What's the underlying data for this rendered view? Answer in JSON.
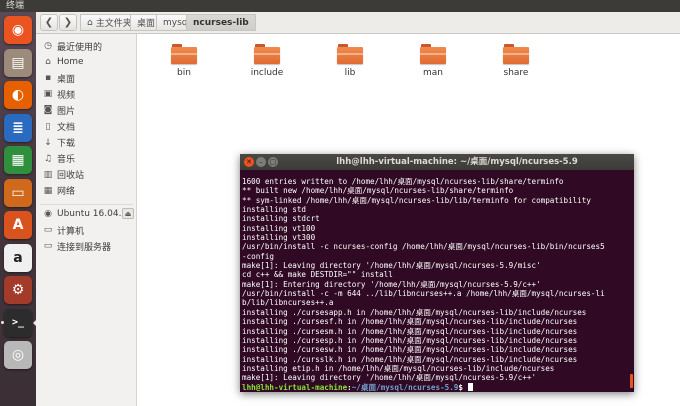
{
  "top_panel": {
    "title": "终端"
  },
  "launcher": {
    "items": [
      {
        "name": "dash",
        "glyph": "◉",
        "color": "#e95420"
      },
      {
        "name": "files",
        "glyph": "▤",
        "color": "#9c8b7a"
      },
      {
        "name": "firefox",
        "glyph": "◐",
        "color": "#e66000"
      },
      {
        "name": "writer",
        "glyph": "≣",
        "color": "#2a6bbf"
      },
      {
        "name": "calc",
        "glyph": "▦",
        "color": "#2f8f3c"
      },
      {
        "name": "impress",
        "glyph": "▭",
        "color": "#d0691c"
      },
      {
        "name": "software-center",
        "glyph": "A",
        "color": "#d9531e"
      },
      {
        "name": "amazon",
        "glyph": "a",
        "color": "#f0f0f0"
      },
      {
        "name": "settings",
        "glyph": "⚙",
        "color": "#a33b2a"
      },
      {
        "name": "terminal",
        "glyph": ">_",
        "color": "#2c2c2c"
      },
      {
        "name": "dvd",
        "glyph": "◎",
        "color": "#b8b8b8"
      }
    ]
  },
  "breadcrumbs": [
    "主文件夹",
    "桌面",
    "mysql",
    "ncurses-lib"
  ],
  "sidebar": {
    "items": [
      {
        "icon": "clock-icon",
        "glyph": "◷",
        "label": "最近使用的"
      },
      {
        "icon": "home-icon",
        "glyph": "⌂",
        "label": "Home"
      },
      {
        "icon": "folder-icon",
        "glyph": "▪",
        "label": "桌面"
      },
      {
        "icon": "video-icon",
        "glyph": "▣",
        "label": "视频"
      },
      {
        "icon": "camera-icon",
        "glyph": "◙",
        "label": "图片"
      },
      {
        "icon": "document-icon",
        "glyph": "▯",
        "label": "文档"
      },
      {
        "icon": "download-icon",
        "glyph": "↓",
        "label": "下载"
      },
      {
        "icon": "music-icon",
        "glyph": "♫",
        "label": "音乐"
      },
      {
        "icon": "trash-icon",
        "glyph": "▥",
        "label": "回收站"
      },
      {
        "icon": "network-icon",
        "glyph": "▦",
        "label": "网络"
      }
    ],
    "devices": [
      {
        "icon": "disc-icon",
        "glyph": "◉",
        "label": "Ubuntu 16.04...."
      },
      {
        "icon": "computer-icon",
        "glyph": "▭",
        "label": "计算机"
      },
      {
        "icon": "server-icon",
        "glyph": "▭",
        "label": "连接到服务器"
      }
    ]
  },
  "folders": [
    "bin",
    "include",
    "lib",
    "man",
    "share"
  ],
  "terminal": {
    "title": "lhh@lhh-virtual-machine: ~/桌面/mysql/ncurses-5.9",
    "lines": [
      "1600 entries written to /home/lhh/桌面/mysql/ncurses-lib/share/terminfo",
      "** built new /home/lhh/桌面/mysql/ncurses-lib/share/terminfo",
      "** sym-linked /home/lhh/桌面/mysql/ncurses-lib/lib/terminfo for compatibility",
      "installing std",
      "installing stdcrt",
      "installing vt100",
      "installing vt300",
      "/usr/bin/install -c ncurses-config /home/lhh/桌面/mysql/ncurses-lib/bin/ncurses5",
      "-config",
      "make[1]: Leaving directory '/home/lhh/桌面/mysql/ncurses-5.9/misc'",
      "cd c++ && make DESTDIR=\"\" install",
      "make[1]: Entering directory '/home/lhh/桌面/mysql/ncurses-5.9/c++'",
      "/usr/bin/install -c -m 644 ../lib/libncurses++.a /home/lhh/桌面/mysql/ncurses-li",
      "b/lib/libncurses++.a",
      "installing ./cursesapp.h in /home/lhh/桌面/mysql/ncurses-lib/include/ncurses",
      "installing ./cursesf.h in /home/lhh/桌面/mysql/ncurses-lib/include/ncurses",
      "installing ./cursesm.h in /home/lhh/桌面/mysql/ncurses-lib/include/ncurses",
      "installing ./cursesp.h in /home/lhh/桌面/mysql/ncurses-lib/include/ncurses",
      "installing ./cursesw.h in /home/lhh/桌面/mysql/ncurses-lib/include/ncurses",
      "installing ./cursslk.h in /home/lhh/桌面/mysql/ncurses-lib/include/ncurses",
      "installing etip.h in /home/lhh/桌面/mysql/ncurses-lib/include/ncurses",
      "make[1]: Leaving directory '/home/lhh/桌面/mysql/ncurses-5.9/c++'"
    ],
    "prompt_user": "lhh@lhh-virtual-machine",
    "prompt_sep": ":",
    "prompt_path": "~/桌面/mysql/ncurses-5.9",
    "prompt_symbol": "$ "
  }
}
